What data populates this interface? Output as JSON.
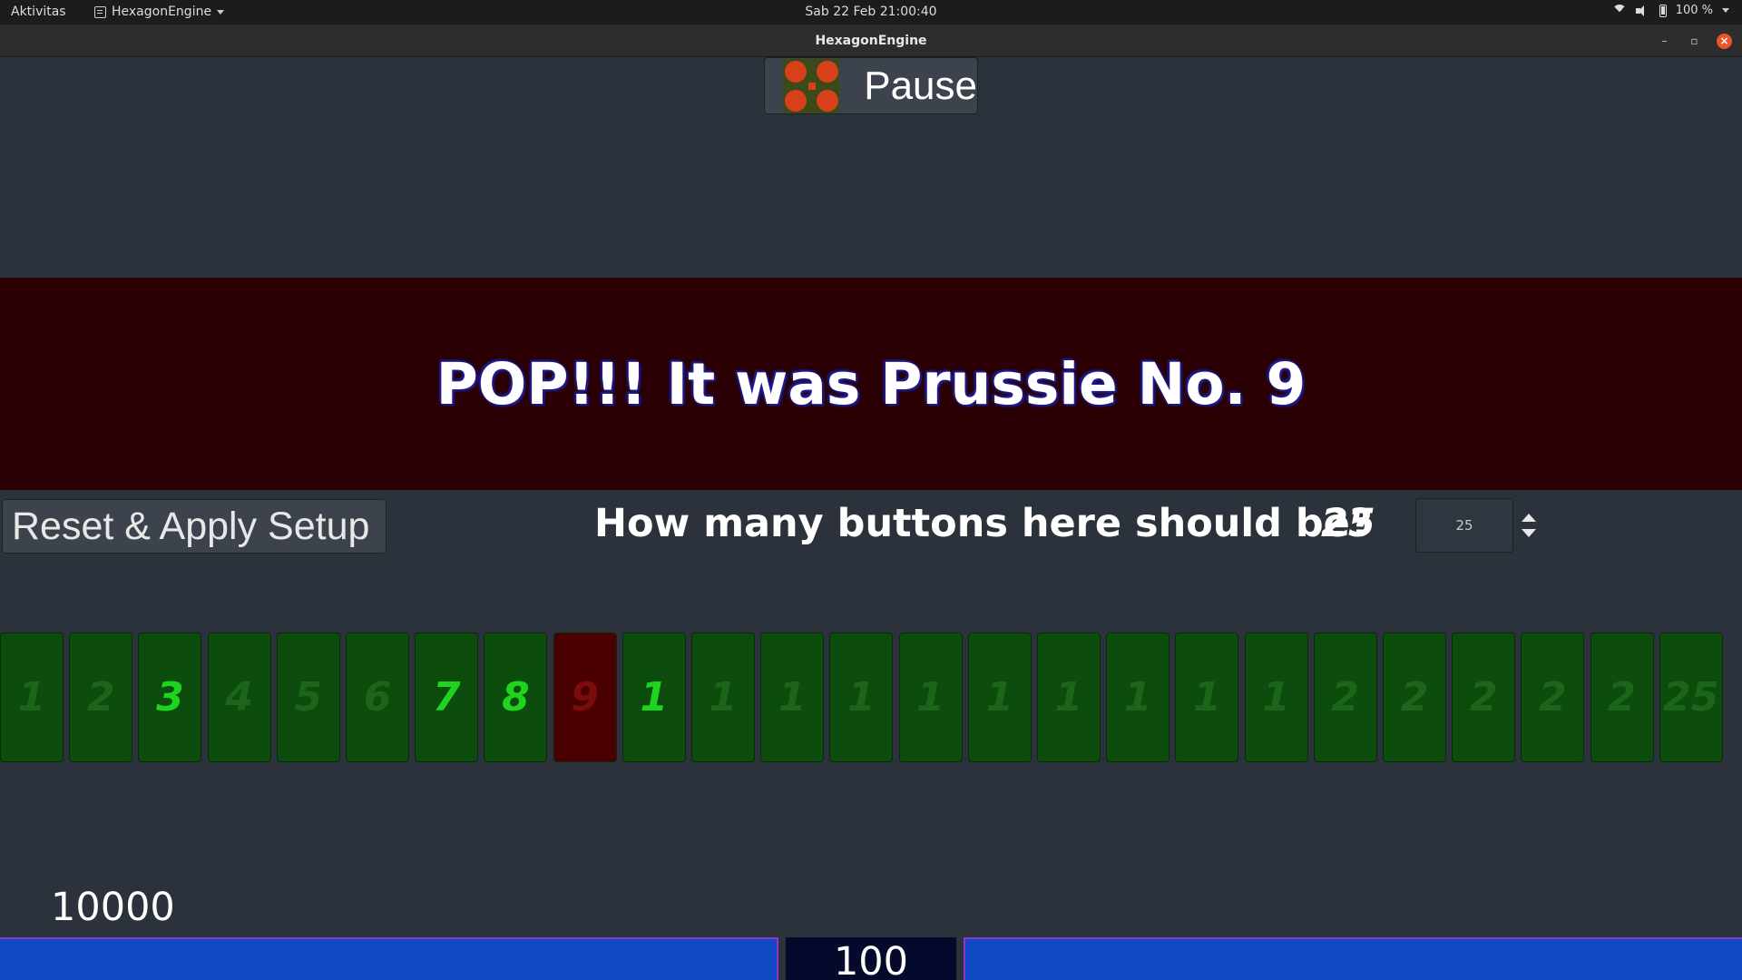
{
  "topbar": {
    "activities": "Aktivitas",
    "app_name": "HexagonEngine",
    "clock": "Sab 22 Feb  21:00:40",
    "battery": "100 %"
  },
  "window": {
    "title": "HexagonEngine"
  },
  "pause": {
    "label": "Pause",
    "icon": "x-shape-icon"
  },
  "banner": {
    "text": "POP!!! It was Prussie No. 9"
  },
  "setup": {
    "reset_label": "Reset & Apply Setup",
    "question": "How many buttons here should be?",
    "count_display": "25",
    "spin_value": "25"
  },
  "number_buttons": [
    {
      "label": "1",
      "state": "dim"
    },
    {
      "label": "2",
      "state": "dim"
    },
    {
      "label": "3",
      "state": "lit"
    },
    {
      "label": "4",
      "state": "dim"
    },
    {
      "label": "5",
      "state": "dim"
    },
    {
      "label": "6",
      "state": "dim"
    },
    {
      "label": "7",
      "state": "lit"
    },
    {
      "label": "8",
      "state": "lit"
    },
    {
      "label": "9",
      "state": "popped"
    },
    {
      "label": "1",
      "state": "lit"
    },
    {
      "label": "1",
      "state": "dim"
    },
    {
      "label": "1",
      "state": "dim"
    },
    {
      "label": "1",
      "state": "dim"
    },
    {
      "label": "1",
      "state": "dim"
    },
    {
      "label": "1",
      "state": "dim"
    },
    {
      "label": "1",
      "state": "dim"
    },
    {
      "label": "1",
      "state": "dim"
    },
    {
      "label": "1",
      "state": "dim"
    },
    {
      "label": "1",
      "state": "dim"
    },
    {
      "label": "2",
      "state": "dim"
    },
    {
      "label": "2",
      "state": "dim"
    },
    {
      "label": "2",
      "state": "dim"
    },
    {
      "label": "2",
      "state": "dim"
    },
    {
      "label": "2",
      "state": "dim"
    },
    {
      "label": "25",
      "state": "dim"
    }
  ],
  "score": "10000",
  "status_center": "100",
  "colors": {
    "background": "#2b323b",
    "banner": "#2a0004",
    "button_green": "#0c4c0c",
    "lit_text": "#1fd41f",
    "popped": "#4a0000",
    "bar_blue": "#1049c6"
  }
}
